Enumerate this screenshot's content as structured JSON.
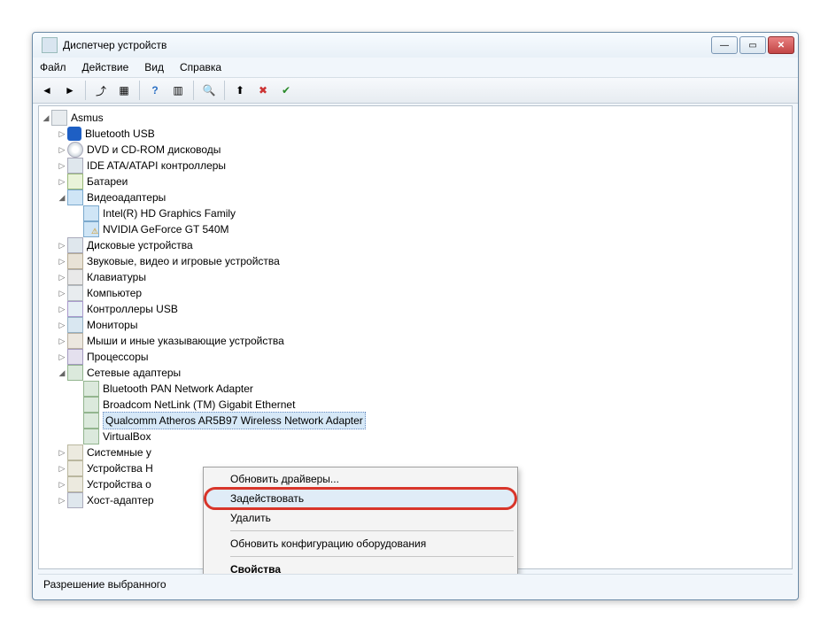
{
  "window": {
    "title": "Диспетчер устройств"
  },
  "menu": {
    "file": "Файл",
    "action": "Действие",
    "view": "Вид",
    "help": "Справка"
  },
  "tree": {
    "root": "Asmus",
    "items": [
      {
        "label": "Bluetooth USB",
        "icon": "bt"
      },
      {
        "label": "DVD и CD-ROM дисководы",
        "icon": "cd"
      },
      {
        "label": "IDE ATA/ATAPI контроллеры",
        "icon": "hdd"
      },
      {
        "label": "Батареи",
        "icon": "bat"
      },
      {
        "label": "Видеоадаптеры",
        "icon": "disp",
        "expanded": true,
        "children": [
          {
            "label": "Intel(R) HD Graphics Family",
            "icon": "disp"
          },
          {
            "label": "NVIDIA GeForce GT 540M",
            "icon": "disp",
            "warn": true
          }
        ]
      },
      {
        "label": "Дисковые устройства",
        "icon": "hdd"
      },
      {
        "label": "Звуковые, видео и игровые устройства",
        "icon": "snd"
      },
      {
        "label": "Клавиатуры",
        "icon": "kbd"
      },
      {
        "label": "Компьютер",
        "icon": "pc"
      },
      {
        "label": "Контроллеры USB",
        "icon": "usb"
      },
      {
        "label": "Мониторы",
        "icon": "mon"
      },
      {
        "label": "Мыши и иные указывающие устройства",
        "icon": "mouse"
      },
      {
        "label": "Процессоры",
        "icon": "cpu"
      },
      {
        "label": "Сетевые адаптеры",
        "icon": "net",
        "expanded": true,
        "children": [
          {
            "label": "Bluetooth PAN Network Adapter",
            "icon": "net"
          },
          {
            "label": "Broadcom NetLink (TM) Gigabit Ethernet",
            "icon": "net"
          },
          {
            "label": "Qualcomm Atheros AR5B97 Wireless Network Adapter",
            "icon": "net",
            "selected": true
          },
          {
            "label": "VirtualBox",
            "icon": "net"
          }
        ]
      },
      {
        "label": "Системные у",
        "icon": "sys"
      },
      {
        "label": "Устройства H",
        "icon": "sys"
      },
      {
        "label": "Устройства о",
        "icon": "sys"
      },
      {
        "label": "Хост-адаптер",
        "icon": "hdd"
      }
    ]
  },
  "context_menu": {
    "update_drivers": "Обновить драйверы...",
    "enable": "Задействовать",
    "delete": "Удалить",
    "scan_hw": "Обновить конфигурацию оборудования",
    "properties": "Свойства"
  },
  "status": "Разрешение выбранного",
  "toolbar_icons": [
    "back-icon",
    "forward-icon",
    "up-icon",
    "show-hidden-icon",
    "help-icon",
    "scan-icon",
    "refresh-icon",
    "update-icon",
    "disable-icon",
    "enable-icon"
  ]
}
